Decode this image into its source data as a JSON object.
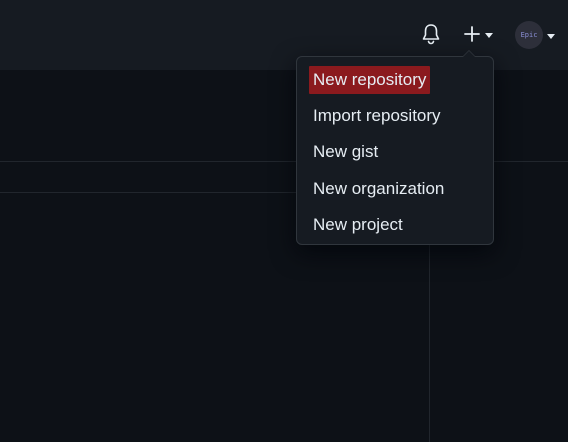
{
  "header": {
    "notifications_icon": "bell-icon",
    "create_icon": "plus-icon",
    "avatar_text": "Epic"
  },
  "create_menu": {
    "items": [
      {
        "label": "New repository",
        "highlighted": true
      },
      {
        "label": "Import repository"
      },
      {
        "label": "New gist"
      },
      {
        "label": "New organization"
      },
      {
        "label": "New project"
      }
    ]
  },
  "colors": {
    "background": "#0d1117",
    "header": "#161b22",
    "highlight": "#8b1a1e",
    "menu_border": "#30363d"
  }
}
